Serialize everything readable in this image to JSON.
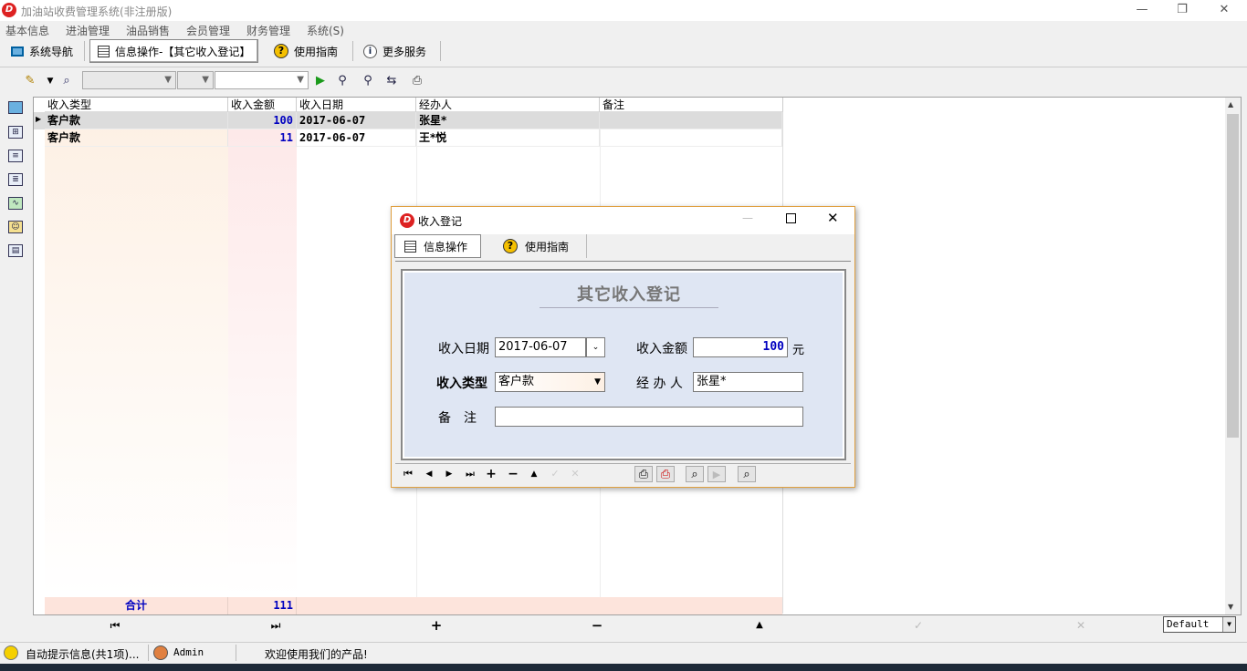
{
  "app": {
    "title": "加油站收费管理系统(非注册版)",
    "logo_text": "D"
  },
  "window_controls": {
    "minimize": "—",
    "restore": "❐",
    "close": "✕"
  },
  "menu": [
    "基本信息",
    "进油管理",
    "油品销售",
    "会员管理",
    "财务管理",
    "系统(S)"
  ],
  "main_tabs": [
    {
      "label": "系统导航",
      "icon": "monitor-icon"
    },
    {
      "label": "信息操作-【其它收入登记】",
      "icon": "grid-icon"
    },
    {
      "label": "使用指南",
      "icon": "help-icon"
    },
    {
      "label": "更多服务",
      "icon": "info-icon"
    }
  ],
  "grid": {
    "columns": [
      "收入类型",
      "收入金额",
      "收入日期",
      "经办人",
      "备注"
    ],
    "rows": [
      {
        "type": "客户款",
        "amount": "100",
        "date": "2017-06-07",
        "handler": "张星*",
        "note": ""
      },
      {
        "type": "客户款",
        "amount": "11",
        "date": "2017-06-07",
        "handler": "王*悦",
        "note": ""
      }
    ],
    "total_label": "合计",
    "total_value": "111",
    "style_combo": "Default"
  },
  "status": {
    "info": "自动提示信息(共1项)...",
    "user": "Admin",
    "message": "欢迎使用我们的产品!"
  },
  "dialog": {
    "title": "收入登记",
    "tabs": [
      "信息操作",
      "使用指南"
    ],
    "heading": "其它收入登记",
    "date_label": "收入日期",
    "date_value": "2017-06-07",
    "amount_label": "收入金额",
    "amount_value": "100",
    "amount_unit": "元",
    "type_label": "收入类型",
    "type_value": "客户款",
    "handler_label": "经 办 人",
    "handler_value": "张星*",
    "note_label": "备　注",
    "note_value": ""
  },
  "colors": {
    "accent_blue": "#0000c0",
    "amount_col_bg": "#fde8e8",
    "type_col_bg": "#fdf0e4",
    "dialog_panel": "#dfe6f3",
    "dialog_border": "#e0a040"
  }
}
